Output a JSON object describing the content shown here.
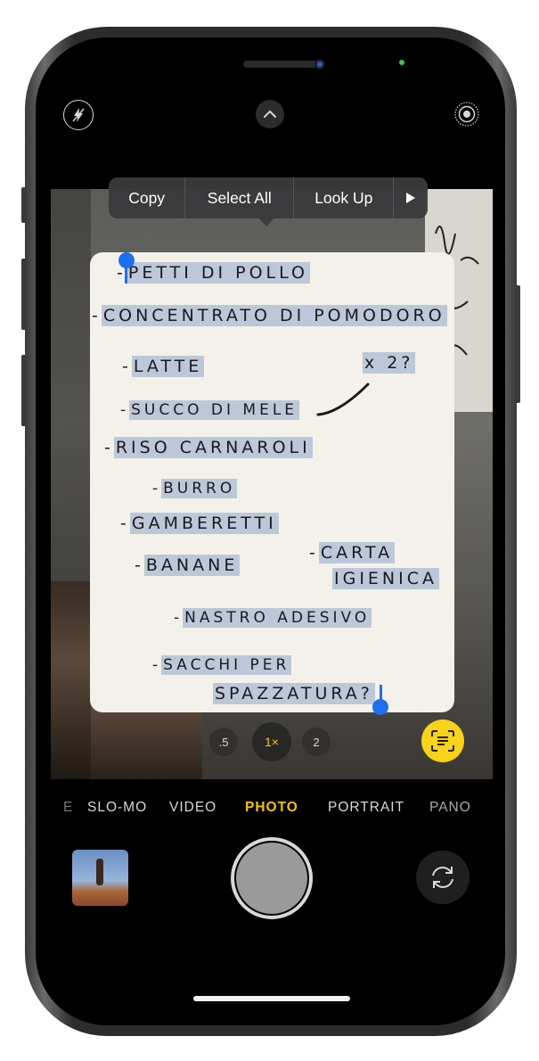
{
  "text_selection_menu": {
    "copy": "Copy",
    "select_all": "Select All",
    "look_up": "Look Up",
    "more_icon": "play-triangle-icon"
  },
  "note_lines": [
    {
      "dash": "-",
      "text": "PETTI DI POLLO"
    },
    {
      "dash": "-",
      "text": "CONCENTRATO DI POMODORO"
    },
    {
      "dash": "-",
      "text": "LATTE"
    },
    {
      "dash": "",
      "text": "x 2?"
    },
    {
      "dash": "-",
      "text": "SUCCO DI MELE"
    },
    {
      "dash": "-",
      "text": "RISO CARNAROLI"
    },
    {
      "dash": "-",
      "text": "BURRO"
    },
    {
      "dash": "-",
      "text": "GAMBERETTI"
    },
    {
      "dash": "-",
      "text": "BANANE"
    },
    {
      "dash": "-",
      "text": "CARTA"
    },
    {
      "dash": "",
      "text": "IGIENICA"
    },
    {
      "dash": "-",
      "text": "NASTRO ADESIVO"
    },
    {
      "dash": "-",
      "text": "SACCHI PER"
    },
    {
      "dash": "",
      "text": "SPAZZATURA?"
    }
  ],
  "zoom": {
    "options": [
      ".5",
      "1×",
      "2"
    ],
    "selected": "1×"
  },
  "camera_modes": {
    "items": [
      "E",
      "SLO-MO",
      "VIDEO",
      "PHOTO",
      "PORTRAIT",
      "PANO"
    ],
    "selected": "PHOTO"
  },
  "icons": {
    "flash": "flash-off-icon",
    "chevron": "chevron-up-icon",
    "live_photo": "live-photo-icon",
    "live_text": "live-text-scan-icon",
    "flip": "camera-flip-icon"
  },
  "colors": {
    "accent": "#f5c400",
    "selection": "#1e6ff0",
    "highlight": "#bcc8da",
    "live_text_button": "#f7d31a"
  }
}
